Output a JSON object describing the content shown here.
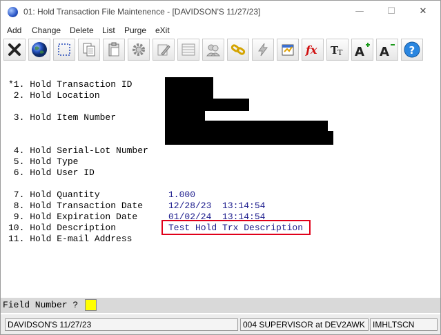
{
  "window": {
    "title": "01: Hold Transaction File Maintenence - [DAVIDSON'S 11/27/23]",
    "controls": {
      "minimize": "—",
      "maximize": "☐",
      "close": "✕"
    }
  },
  "menu": [
    "Add",
    "Change",
    "Delete",
    "List",
    "Purge",
    "eXit"
  ],
  "toolbar": [
    {
      "name": "exit-button",
      "icon": "x-icon"
    },
    {
      "name": "globe-button",
      "icon": "globe-icon"
    },
    {
      "name": "select-button",
      "icon": "dashed-square-icon"
    },
    {
      "name": "copy-button",
      "icon": "copy-icon"
    },
    {
      "name": "paste-button",
      "icon": "paste-icon"
    },
    {
      "name": "settings-button",
      "icon": "gear-icon"
    },
    {
      "name": "edit-button",
      "icon": "pencil-icon"
    },
    {
      "name": "list-button",
      "icon": "list-icon"
    },
    {
      "name": "users-button",
      "icon": "users-icon"
    },
    {
      "name": "link-button",
      "icon": "chain-icon"
    },
    {
      "name": "lightning-button",
      "icon": "lightning-icon"
    },
    {
      "name": "calendar-button",
      "icon": "calendar-icon"
    },
    {
      "name": "function-button",
      "icon": "fx-icon"
    },
    {
      "name": "font-button",
      "icon": "font-icon"
    },
    {
      "name": "font-increase-button",
      "icon": "font-plus-icon"
    },
    {
      "name": "font-decrease-button",
      "icon": "font-minus-icon"
    },
    {
      "name": "help-button",
      "icon": "help-icon"
    }
  ],
  "fields": [
    {
      "label": "*1. Hold Transaction ID",
      "value": ""
    },
    {
      "label": " 2. Hold Location",
      "value": ""
    },
    {
      "label": " 3. Hold Item Number",
      "value": ""
    },
    {
      "label": " 4. Hold Serial-Lot Number",
      "value": ""
    },
    {
      "label": " 5. Hold Type",
      "value": ""
    },
    {
      "label": " 6. Hold User ID",
      "value": ""
    },
    {
      "label": " 7. Hold Quantity",
      "value": "1.000"
    },
    {
      "label": " 8. Hold Transaction Date",
      "value": "12/28/23  13:14:54"
    },
    {
      "label": " 9. Hold Expiration Date",
      "value": "01/02/24  13:14:54"
    },
    {
      "label": "10. Hold Description",
      "value": "Test Hold Trx Description"
    },
    {
      "label": "11. Hold E-mail Address",
      "value": ""
    }
  ],
  "prompt": {
    "label": "Field Number ?",
    "value": ""
  },
  "status": {
    "company": "DAVIDSON'S 11/27/23",
    "user": "004 SUPERVISOR at DEV2AWK",
    "program": "IMHLTSCN"
  },
  "colors": {
    "value_text": "#1a1a8c",
    "highlight_border": "#e0001a",
    "prompt_input": "#ffff00"
  }
}
